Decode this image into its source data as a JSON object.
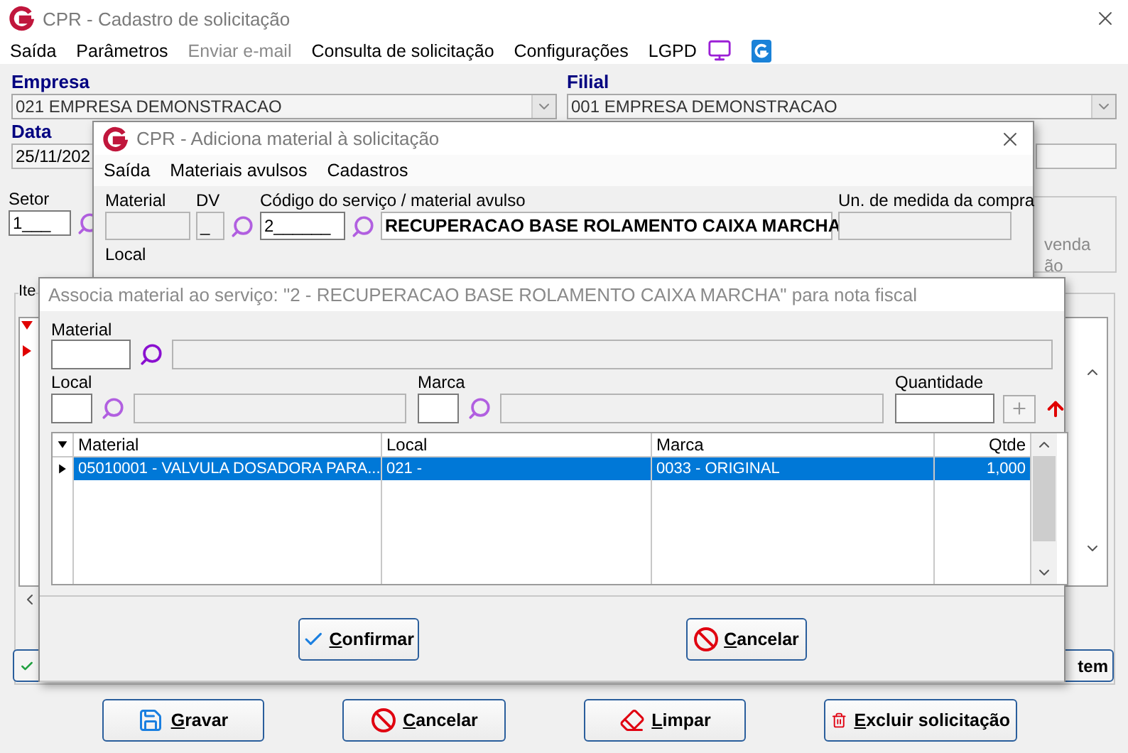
{
  "main_window": {
    "title": "CPR - Cadastro de solicitação",
    "menu": [
      {
        "label": "Saída",
        "disabled": false
      },
      {
        "label": "Parâmetros",
        "disabled": false
      },
      {
        "label": "Enviar e-mail",
        "disabled": true
      },
      {
        "label": "Consulta de solicitação",
        "disabled": false
      },
      {
        "label": "Configurações",
        "disabled": false
      },
      {
        "label": "LGPD",
        "disabled": false
      }
    ],
    "empresa": {
      "label": "Empresa",
      "value": "021 EMPRESA DEMONSTRACAO"
    },
    "filial": {
      "label": "Filial",
      "value": "001 EMPRESA DEMONSTRACAO"
    },
    "data": {
      "label": "Data",
      "value": "25/11/202"
    },
    "setor": {
      "label": "Setor",
      "value": "1___"
    },
    "side_texts": [
      "venda",
      "ão"
    ],
    "items_group": {
      "label": "Ite",
      "right_button": "tem"
    },
    "buttons": [
      {
        "kind": "save",
        "label": "Gravar"
      },
      {
        "kind": "cancel",
        "label": "Cancelar"
      },
      {
        "kind": "clear",
        "label": "Limpar"
      },
      {
        "kind": "delete",
        "label": "Excluir solicitação"
      }
    ]
  },
  "add_dialog": {
    "title": "CPR - Adiciona material à solicitação",
    "menu": [
      "Saída",
      "Materiais avulsos",
      "Cadastros"
    ],
    "material": {
      "label": "Material"
    },
    "dv": {
      "label": "DV",
      "value": "_"
    },
    "service": {
      "label": "Código do serviço / material avulso",
      "code": "2______",
      "description": "RECUPERACAO BASE ROLAMENTO CAIXA MARCHA"
    },
    "unit": {
      "label": "Un. de medida da compra"
    },
    "local": {
      "label": "Local"
    }
  },
  "associate_dialog": {
    "title": "Associa material ao serviço: \"2 - RECUPERACAO BASE ROLAMENTO CAIXA MARCHA\" para nota fiscal",
    "material": {
      "label": "Material"
    },
    "local": {
      "label": "Local"
    },
    "marca": {
      "label": "Marca"
    },
    "quantidade": {
      "label": "Quantidade"
    },
    "columns": [
      "Material",
      "Local",
      "Marca",
      "Qtde"
    ],
    "rows": [
      {
        "cells": [
          "05010001 - VALVULA DOSADORA PARA...",
          "021 - ",
          "0033 - ORIGINAL",
          "1,000"
        ],
        "selected": true
      }
    ],
    "buttons": [
      {
        "kind": "confirm",
        "label": "Confirmar"
      },
      {
        "kind": "cancel",
        "label": "Cancelar"
      }
    ]
  }
}
